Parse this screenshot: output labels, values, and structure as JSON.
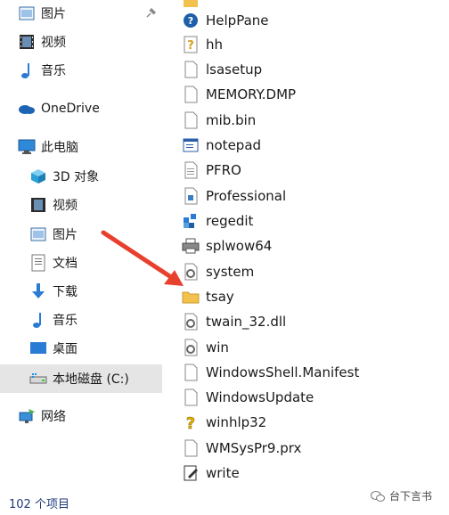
{
  "nav": {
    "items": [
      {
        "label": "图片",
        "icon": "pictures-icon"
      },
      {
        "label": "视频",
        "icon": "videos-icon"
      },
      {
        "label": "音乐",
        "icon": "music-icon"
      },
      {
        "label": "OneDrive",
        "icon": "onedrive-icon"
      },
      {
        "label": "此电脑",
        "icon": "this-pc-icon"
      },
      {
        "label": "3D 对象",
        "icon": "3d-objects-icon"
      },
      {
        "label": "视频",
        "icon": "videos-icon"
      },
      {
        "label": "图片",
        "icon": "pictures-icon"
      },
      {
        "label": "文档",
        "icon": "documents-icon"
      },
      {
        "label": "下载",
        "icon": "downloads-icon"
      },
      {
        "label": "音乐",
        "icon": "music-icon"
      },
      {
        "label": "桌面",
        "icon": "desktop-icon"
      },
      {
        "label": "本地磁盘 (C:)",
        "icon": "drive-icon"
      },
      {
        "label": "网络",
        "icon": "network-icon"
      }
    ]
  },
  "files": [
    {
      "name": "HelpPane",
      "icon": "help-icon"
    },
    {
      "name": "hh",
      "icon": "help-file-icon"
    },
    {
      "name": "lsasetup",
      "icon": "file-icon"
    },
    {
      "name": "MEMORY.DMP",
      "icon": "file-icon"
    },
    {
      "name": "mib.bin",
      "icon": "file-icon"
    },
    {
      "name": "notepad",
      "icon": "notepad-icon"
    },
    {
      "name": "PFRO",
      "icon": "text-file-icon"
    },
    {
      "name": "Professional",
      "icon": "xml-file-icon"
    },
    {
      "name": "regedit",
      "icon": "regedit-icon"
    },
    {
      "name": "splwow64",
      "icon": "printer-icon"
    },
    {
      "name": "system",
      "icon": "settings-file-icon"
    },
    {
      "name": "tsay",
      "icon": "folder-icon"
    },
    {
      "name": "twain_32.dll",
      "icon": "settings-file-icon"
    },
    {
      "name": "win",
      "icon": "settings-file-icon"
    },
    {
      "name": "WindowsShell.Manifest",
      "icon": "file-icon"
    },
    {
      "name": "WindowsUpdate",
      "icon": "file-icon"
    },
    {
      "name": "winhlp32",
      "icon": "help-icon-yellow"
    },
    {
      "name": "WMSysPr9.prx",
      "icon": "file-icon"
    },
    {
      "name": "write",
      "icon": "write-icon"
    }
  ],
  "status": {
    "item_count": "102 个项目"
  },
  "watermark": {
    "text": "台下言书"
  },
  "colors": {
    "selected_bg": "#e5e5e5",
    "arrow": "#e8402f",
    "folder": "#f2c14e",
    "accent": "#0078d7"
  }
}
